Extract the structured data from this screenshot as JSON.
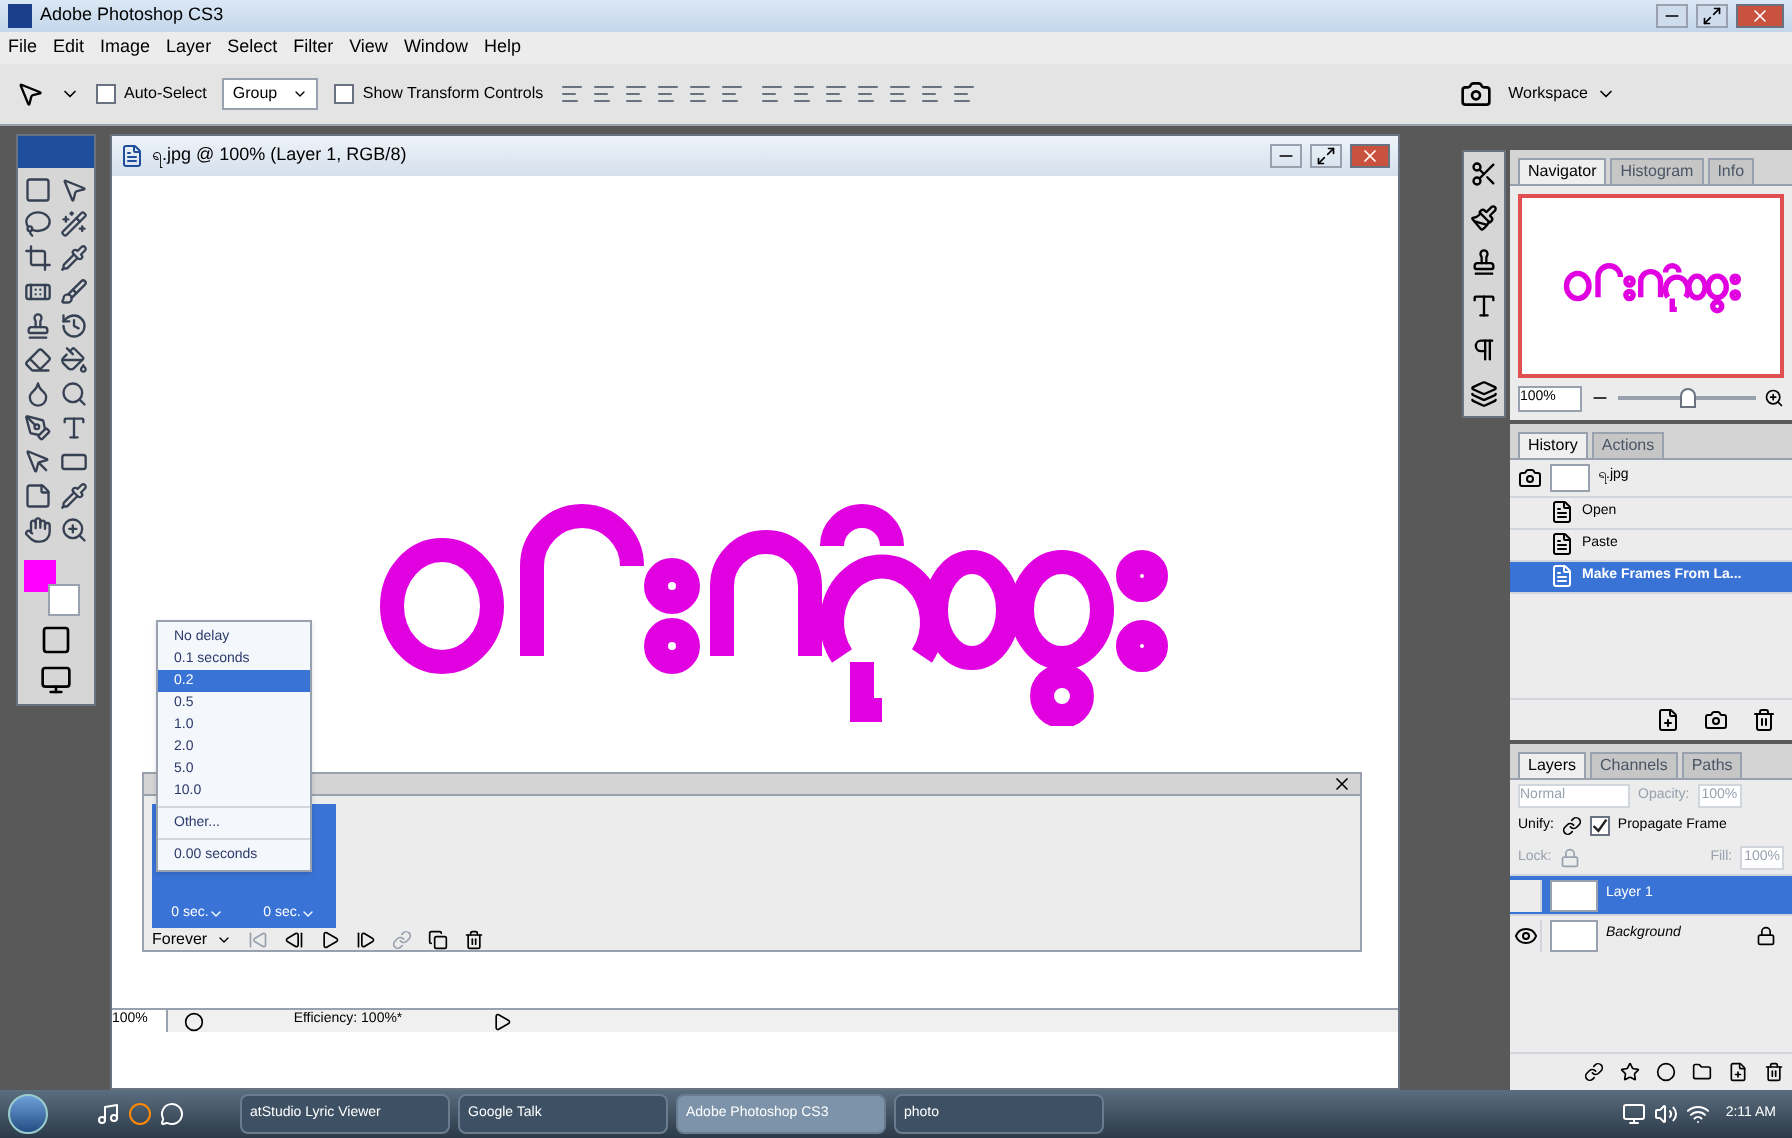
{
  "window": {
    "title": "Adobe Photoshop CS3"
  },
  "menu": [
    "File",
    "Edit",
    "Image",
    "Layer",
    "Select",
    "Filter",
    "View",
    "Window",
    "Help"
  ],
  "options_bar": {
    "auto_select": {
      "label": "Auto-Select",
      "checked": false,
      "value": "Group"
    },
    "show_transform": {
      "label": "Show Transform Controls",
      "checked": false
    },
    "workspace": "Workspace"
  },
  "document": {
    "title": "ရ.jpg @ 100% (Layer 1, RGB/8)",
    "zoom": "100%",
    "efficiency": "Efficiency: 100%*"
  },
  "animation": {
    "frames": [
      {
        "delay": "0 sec.",
        "selected": true
      },
      {
        "delay": "0 sec.",
        "selected": true
      }
    ],
    "loop": "Forever"
  },
  "delay_menu": {
    "items": [
      {
        "label": "No delay",
        "selected": false
      },
      {
        "label": "0.1 seconds",
        "selected": false
      },
      {
        "label": "0.2",
        "selected": true
      },
      {
        "label": "0.5",
        "selected": false
      },
      {
        "label": "1.0",
        "selected": false
      },
      {
        "label": "2.0",
        "selected": false
      },
      {
        "label": "5.0",
        "selected": false
      },
      {
        "label": "10.0",
        "selected": false
      }
    ],
    "other": "Other...",
    "current": "0.00 seconds"
  },
  "navigator": {
    "tabs": [
      {
        "label": "Navigator",
        "selected": true
      },
      {
        "label": "Histogram",
        "selected": false
      },
      {
        "label": "Info",
        "selected": false
      }
    ],
    "zoom": "100%",
    "level": 0.5
  },
  "history": {
    "tabs": [
      {
        "label": "History",
        "selected": true
      },
      {
        "label": "Actions",
        "selected": false
      }
    ],
    "snapshot": "ရ.jpg",
    "items": [
      {
        "label": "Open",
        "selected": false
      },
      {
        "label": "Paste",
        "selected": false
      },
      {
        "label": "Make Frames From La...",
        "selected": true
      }
    ]
  },
  "layers": {
    "tabs": [
      {
        "label": "Layers",
        "selected": true
      },
      {
        "label": "Channels",
        "selected": false
      },
      {
        "label": "Paths",
        "selected": false
      }
    ],
    "blend_mode": "Normal",
    "opacity_label": "Opacity:",
    "opacity": "100%",
    "unify_label": "Unify:",
    "propagate": {
      "label": "Propagate Frame",
      "checked": true
    },
    "lock_label": "Lock:",
    "fill_label": "Fill:",
    "fill": "100%",
    "items": [
      {
        "name": "Layer 1",
        "selected": true,
        "visible": false,
        "locked": false
      },
      {
        "name": "Background",
        "selected": false,
        "visible": true,
        "locked": true
      }
    ]
  },
  "taskbar": {
    "buttons": [
      {
        "label": "atStudio Lyric Viewer",
        "active": false
      },
      {
        "label": "Google Talk",
        "active": false
      },
      {
        "label": "Adobe Photoshop CS3",
        "active": true
      },
      {
        "label": "photo",
        "active": false
      }
    ],
    "clock": "2:11 AM"
  }
}
